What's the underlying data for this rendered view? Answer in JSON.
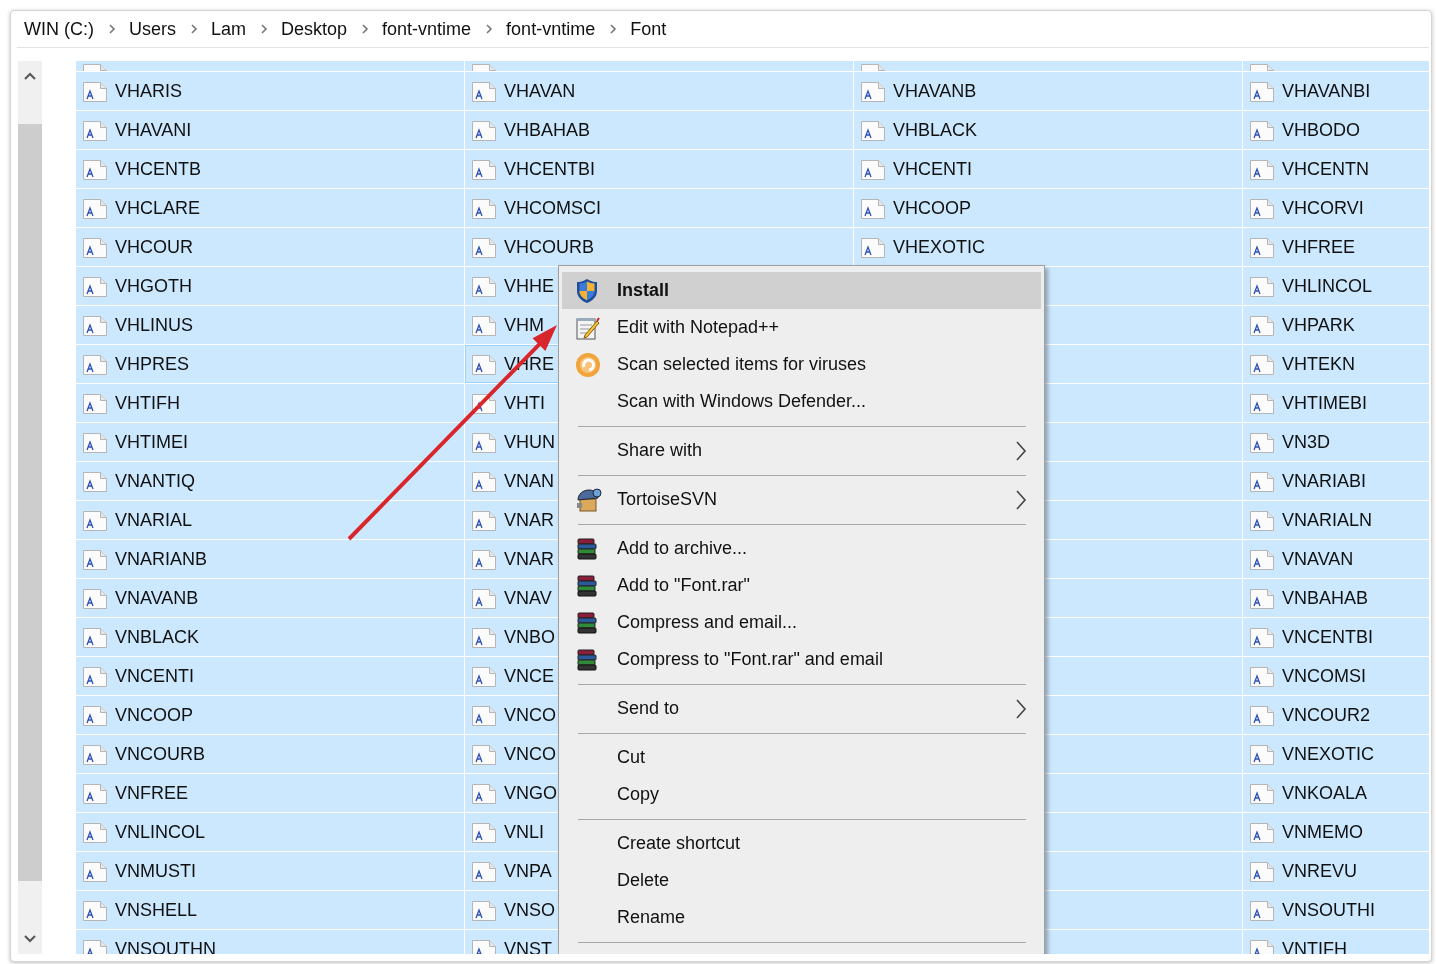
{
  "breadcrumb": [
    "WIN (C:)",
    "Users",
    "Lam",
    "Desktop",
    "font-vntime",
    "font-vntime",
    "Font"
  ],
  "file_list": {
    "columns": [
      {
        "items": [
          {
            "name": "VHARIS",
            "selected": true,
            "focused": false
          },
          {
            "name": "VHAVANI",
            "selected": true,
            "focused": false
          },
          {
            "name": "VHCENTB",
            "selected": true,
            "focused": false
          },
          {
            "name": "VHCLARE",
            "selected": true,
            "focused": false
          },
          {
            "name": "VHCOUR",
            "selected": true,
            "focused": false
          },
          {
            "name": "VHGOTH",
            "selected": true,
            "focused": false
          },
          {
            "name": "VHLINUS",
            "selected": true,
            "focused": false
          },
          {
            "name": "VHPRES",
            "selected": true,
            "focused": false
          },
          {
            "name": "VHTIFH",
            "selected": true,
            "focused": false
          },
          {
            "name": "VHTIMEI",
            "selected": true,
            "focused": false
          },
          {
            "name": "VNANTIQ",
            "selected": true,
            "focused": false
          },
          {
            "name": "VNARIAL",
            "selected": true,
            "focused": false
          },
          {
            "name": "VNARIANB",
            "selected": true,
            "focused": false
          },
          {
            "name": "VNAVANB",
            "selected": true,
            "focused": false
          },
          {
            "name": "VNBLACK",
            "selected": true,
            "focused": false
          },
          {
            "name": "VNCENTI",
            "selected": true,
            "focused": false
          },
          {
            "name": "VNCOOP",
            "selected": true,
            "focused": false
          },
          {
            "name": "VNCOURB",
            "selected": true,
            "focused": false
          },
          {
            "name": "VNFREE",
            "selected": true,
            "focused": false
          },
          {
            "name": "VNLINCOL",
            "selected": true,
            "focused": false
          },
          {
            "name": "VNMUSTI",
            "selected": true,
            "focused": false
          },
          {
            "name": "VNSHELL",
            "selected": true,
            "focused": false
          },
          {
            "name": "VNSOUTHN",
            "selected": true,
            "focused": false
          }
        ]
      },
      {
        "items": [
          {
            "name": "VHAVAN",
            "selected": true,
            "focused": false
          },
          {
            "name": "VHBAHAB",
            "selected": true,
            "focused": false
          },
          {
            "name": "VHCENTBI",
            "selected": true,
            "focused": false
          },
          {
            "name": "VHCOMSCI",
            "selected": true,
            "focused": false
          },
          {
            "name": "VHCOURB",
            "selected": true,
            "focused": false
          },
          {
            "name": "VHHE",
            "selected": true,
            "focused": false
          },
          {
            "name": "VHM",
            "selected": true,
            "focused": false
          },
          {
            "name": "VHRE",
            "selected": true,
            "focused": true
          },
          {
            "name": "VHTI",
            "selected": true,
            "focused": false
          },
          {
            "name": "VHUN",
            "selected": true,
            "focused": false
          },
          {
            "name": "VNAN",
            "selected": true,
            "focused": false
          },
          {
            "name": "VNAR",
            "selected": true,
            "focused": false
          },
          {
            "name": "VNAR",
            "selected": true,
            "focused": false
          },
          {
            "name": "VNAV",
            "selected": true,
            "focused": false
          },
          {
            "name": "VNBO",
            "selected": true,
            "focused": false
          },
          {
            "name": "VNCE",
            "selected": true,
            "focused": false
          },
          {
            "name": "VNCO",
            "selected": true,
            "focused": false
          },
          {
            "name": "VNCO",
            "selected": true,
            "focused": false
          },
          {
            "name": "VNGO",
            "selected": true,
            "focused": false
          },
          {
            "name": "VNLI",
            "selected": true,
            "focused": false
          },
          {
            "name": "VNPA",
            "selected": true,
            "focused": false
          },
          {
            "name": "VNSO",
            "selected": true,
            "focused": false
          },
          {
            "name": "VNST",
            "selected": true,
            "focused": false
          }
        ]
      },
      {
        "items": [
          {
            "name": "VHAVANB",
            "selected": true,
            "focused": false
          },
          {
            "name": "VHBLACK",
            "selected": true,
            "focused": false
          },
          {
            "name": "VHCENTI",
            "selected": true,
            "focused": false
          },
          {
            "name": "VHCOOP",
            "selected": true,
            "focused": false
          },
          {
            "name": "VHEXOTIC",
            "selected": true,
            "focused": false
          }
        ]
      },
      {
        "items": [
          {
            "name": "VHAVANBI",
            "selected": true,
            "focused": false
          },
          {
            "name": "VHBODO",
            "selected": true,
            "focused": false
          },
          {
            "name": "VHCENTN",
            "selected": true,
            "focused": false
          },
          {
            "name": "VHCORVI",
            "selected": true,
            "focused": false
          },
          {
            "name": "VHFREE",
            "selected": true,
            "focused": false
          },
          {
            "name": "VHLINCOL",
            "selected": true,
            "focused": false
          },
          {
            "name": "VHPARK",
            "selected": true,
            "focused": false
          },
          {
            "name": "VHTEKN",
            "selected": true,
            "focused": false
          },
          {
            "name": "VHTIMEBI",
            "selected": true,
            "focused": false
          },
          {
            "name": "VN3D",
            "selected": true,
            "focused": false
          },
          {
            "name": "VNARIABI",
            "selected": true,
            "focused": false
          },
          {
            "name": "VNARIALN",
            "selected": true,
            "focused": false
          },
          {
            "name": "VNAVAN",
            "selected": true,
            "focused": false
          },
          {
            "name": "VNBAHAB",
            "selected": true,
            "focused": false
          },
          {
            "name": "VNCENTBI",
            "selected": true,
            "focused": false
          },
          {
            "name": "VNCOMSI",
            "selected": true,
            "focused": false
          },
          {
            "name": "VNCOUR2",
            "selected": true,
            "focused": false
          },
          {
            "name": "VNEXOTIC",
            "selected": true,
            "focused": false
          },
          {
            "name": "VNKOALA",
            "selected": true,
            "focused": false
          },
          {
            "name": "VNMEMO",
            "selected": true,
            "focused": false
          },
          {
            "name": "VNREVU",
            "selected": true,
            "focused": false
          },
          {
            "name": "VNSOUTHI",
            "selected": true,
            "focused": false
          },
          {
            "name": "VNTIFH",
            "selected": true,
            "focused": false
          }
        ]
      }
    ]
  },
  "context_menu": {
    "items": [
      {
        "kind": "command",
        "label": "Install",
        "selected": true,
        "default": true
      },
      {
        "kind": "command",
        "label": "Edit with Notepad++",
        "selected": false,
        "default": false
      },
      {
        "kind": "command",
        "label": "Scan selected items for viruses",
        "selected": false,
        "default": false
      },
      {
        "kind": "command",
        "label": "Scan with Windows Defender...",
        "selected": false,
        "default": false
      },
      {
        "kind": "separator"
      },
      {
        "kind": "submenu",
        "label": "Share with",
        "selected": false,
        "default": false
      },
      {
        "kind": "separator"
      },
      {
        "kind": "submenu",
        "label": "TortoiseSVN",
        "selected": false,
        "default": false
      },
      {
        "kind": "separator"
      },
      {
        "kind": "command",
        "label": "Add to archive...",
        "selected": false,
        "default": false
      },
      {
        "kind": "command",
        "label": "Add to \"Font.rar\"",
        "selected": false,
        "default": false
      },
      {
        "kind": "command",
        "label": "Compress and email...",
        "selected": false,
        "default": false
      },
      {
        "kind": "command",
        "label": "Compress to \"Font.rar\" and email",
        "selected": false,
        "default": false
      },
      {
        "kind": "separator"
      },
      {
        "kind": "submenu",
        "label": "Send to",
        "selected": false,
        "default": false
      },
      {
        "kind": "separator"
      },
      {
        "kind": "command",
        "label": "Cut",
        "selected": false,
        "default": false
      },
      {
        "kind": "command",
        "label": "Copy",
        "selected": false,
        "default": false
      },
      {
        "kind": "separator"
      },
      {
        "kind": "command",
        "label": "Create shortcut",
        "selected": false,
        "default": false
      },
      {
        "kind": "command",
        "label": "Delete",
        "selected": false,
        "default": false
      },
      {
        "kind": "command",
        "label": "Rename",
        "selected": false,
        "default": false
      },
      {
        "kind": "separator"
      }
    ]
  }
}
